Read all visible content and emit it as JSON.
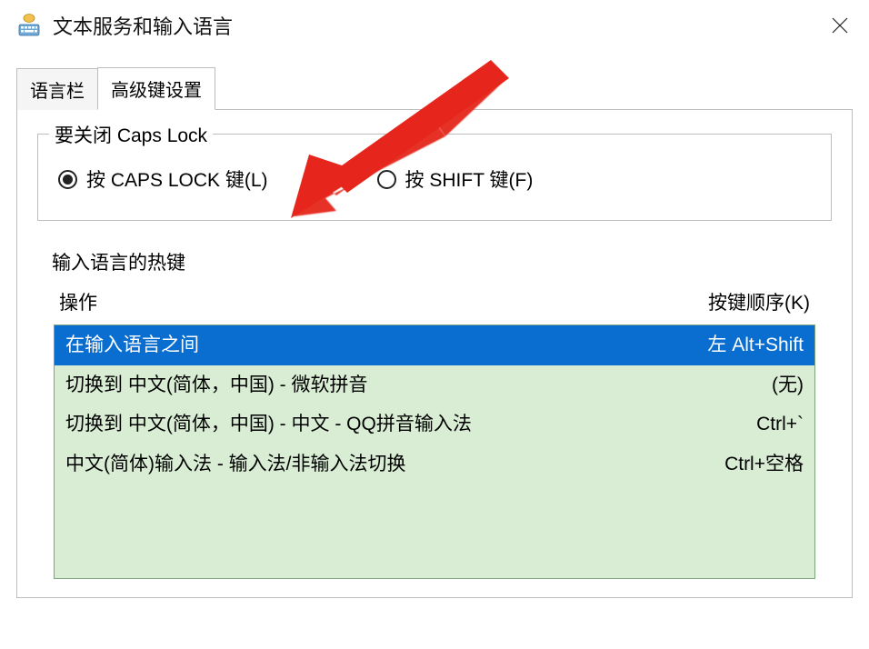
{
  "window": {
    "title": "文本服务和输入语言"
  },
  "tabs": {
    "lang_bar": "语言栏",
    "advanced": "高级键设置"
  },
  "capslock_group": {
    "legend": "要关闭 Caps Lock",
    "option1": "按 CAPS LOCK 键(L)",
    "option2": "按 SHIFT 键(F)"
  },
  "hotkeys": {
    "legend": "输入语言的热键",
    "header_action": "操作",
    "header_keys": "按键顺序(K)",
    "rows": [
      {
        "action": "在输入语言之间",
        "keys": "左 Alt+Shift",
        "selected": true
      },
      {
        "action": "切换到 中文(简体，中国) - 微软拼音",
        "keys": "(无)",
        "selected": false
      },
      {
        "action": "切换到 中文(简体，中国) - 中文 - QQ拼音输入法",
        "keys": "Ctrl+`",
        "selected": false
      },
      {
        "action": "中文(简体)输入法 - 输入法/非输入法切换",
        "keys": "Ctrl+空格",
        "selected": false
      }
    ]
  }
}
